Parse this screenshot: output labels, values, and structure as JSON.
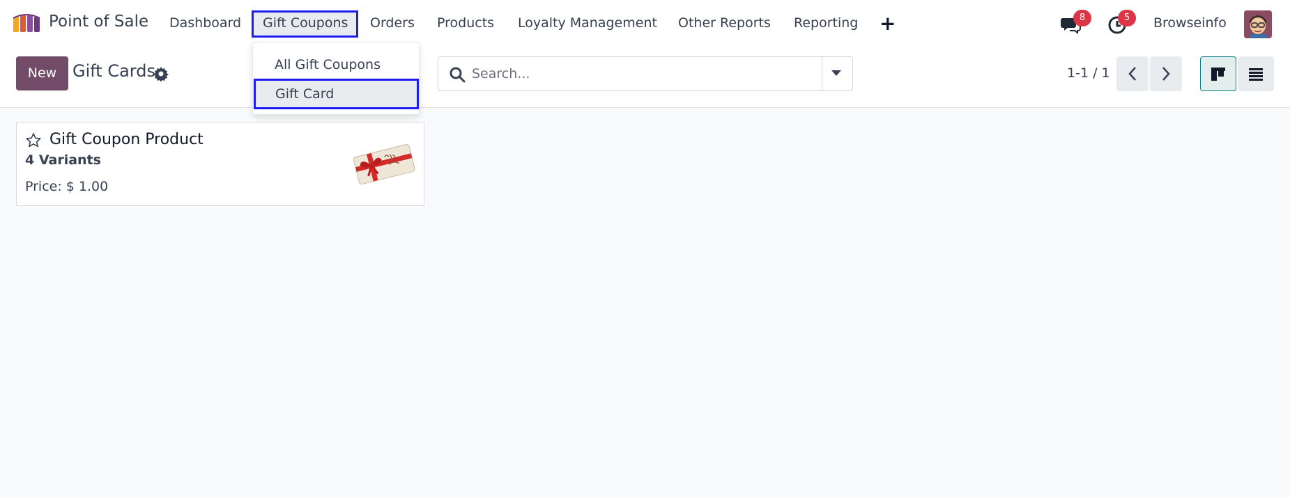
{
  "app": {
    "name": "Point of Sale"
  },
  "nav": {
    "items": [
      "Dashboard",
      "Gift Coupons",
      "Orders",
      "Products",
      "Loyalty Management",
      "Other Reports",
      "Reporting"
    ],
    "active": "Gift Coupons"
  },
  "systray": {
    "messages_count": "8",
    "activities_count": "5",
    "company": "Browseinfo"
  },
  "control": {
    "new_label": "New",
    "title": "Gift Cards",
    "search_placeholder": "Search...",
    "pager": "1-1 / 1"
  },
  "dropdown": {
    "items": [
      "All Gift Coupons",
      "Gift Card"
    ],
    "highlighted": "Gift Card"
  },
  "card": {
    "title": "Gift Coupon Product",
    "variants": "4 Variants",
    "price": "Price: $ 1.00"
  },
  "colors": {
    "brand": "#714b67",
    "highlight": "#1d1df0",
    "badge": "#dc3545"
  }
}
